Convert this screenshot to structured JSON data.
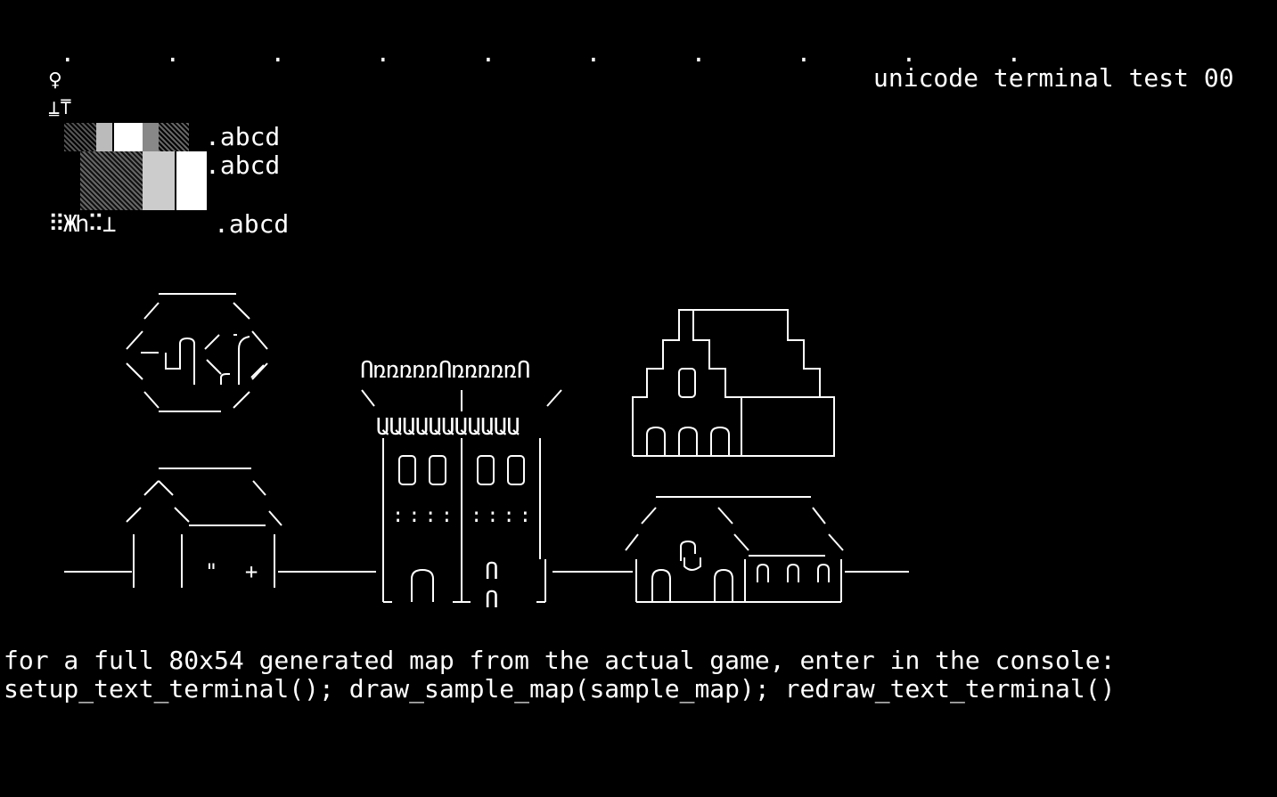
{
  "terminal": {
    "dots_row": "    .      .      .      .      .      .      .      .      .      .",
    "title": "unicode terminal test 00",
    "glyph_row_1": "♀",
    "glyph_row_2": "⍊⍑",
    "glyph_row_3": "⠿Ж𐌷⠭⊥",
    "abcd_1": ".abcd",
    "abcd_2": ".abcd",
    "abcd_3": ".abcd",
    "footer_line_1": "for a full 80x54 generated map from the actual game, enter in the console:",
    "footer_line_2": "setup_text_terminal(); draw_sample_map(sample_map); redraw_text_terminal()",
    "tower_top_text": "ՈռռռռռՈռռռռռՈ",
    "tower_mid_text": "ԱԱԱԱԱԱԱԱԱԱԱ",
    "tower_window_marks": "::::",
    "door_glyph": "ՈՈ",
    "house_door_marks": "\" +",
    "icons": [
      "female-symbol-icon",
      "box-drawing-glyphs-icon",
      "shade-block-icon"
    ],
    "colors": {
      "background": "#000000",
      "foreground": "#ffffff"
    }
  }
}
